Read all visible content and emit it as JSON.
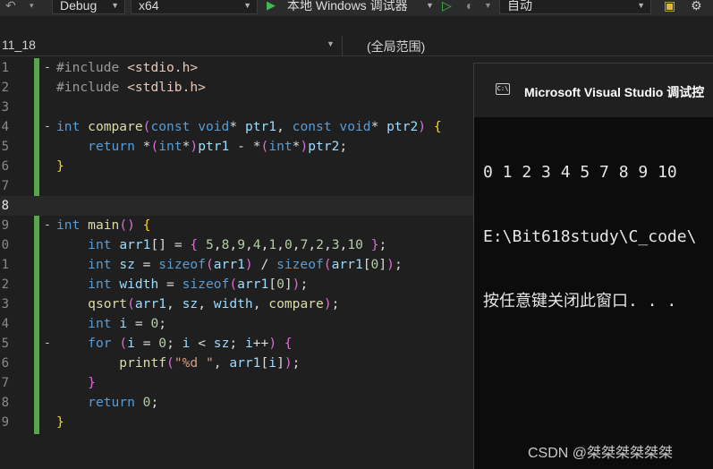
{
  "toolbar": {
    "configuration": "Debug",
    "platform": "x64",
    "debugger_label": "本地 Windows 调试器",
    "attach_value": "自动",
    "colors": {
      "run": "#3fb950"
    }
  },
  "navbar": {
    "project_partial": "11_18",
    "scope": "(全局范围)"
  },
  "editor": {
    "line_numbers": [
      "1",
      "2",
      "3",
      "4",
      "5",
      "6",
      "7",
      "8",
      "9",
      "0",
      "1",
      "2",
      "3",
      "4",
      "5",
      "6",
      "7",
      "8",
      "9"
    ],
    "current_line_index": 7
  },
  "console": {
    "title": "Microsoft Visual Studio 调试控",
    "output_line1": "0 1 2 3 4 5 7 8 9 10",
    "output_line2": "E:\\Bit618study\\C_code\\",
    "output_line3": "按任意键关闭此窗口. . ."
  },
  "watermark": "CSDN @桀桀桀桀桀桀"
}
